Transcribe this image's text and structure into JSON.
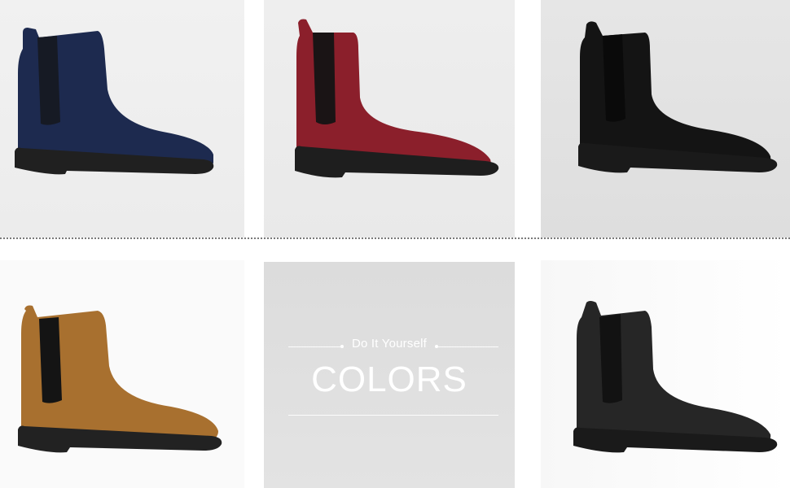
{
  "diy_banner": {
    "tagline": "Do It Yourself",
    "headline": "COLORS"
  },
  "swatches": [
    {
      "color_name": "navy",
      "hex": "#1d2a4f"
    },
    {
      "color_name": "burgundy",
      "hex": "#8b1f2b"
    },
    {
      "color_name": "black",
      "hex": "#141414"
    },
    {
      "color_name": "tan",
      "hex": "#a8702f"
    },
    {
      "color_name": "charcoal black",
      "hex": "#262626"
    }
  ],
  "accent_colors": {
    "divider": "#7a7a7a",
    "banner_text": "#ffffff",
    "banner_bg": "#dedede"
  }
}
